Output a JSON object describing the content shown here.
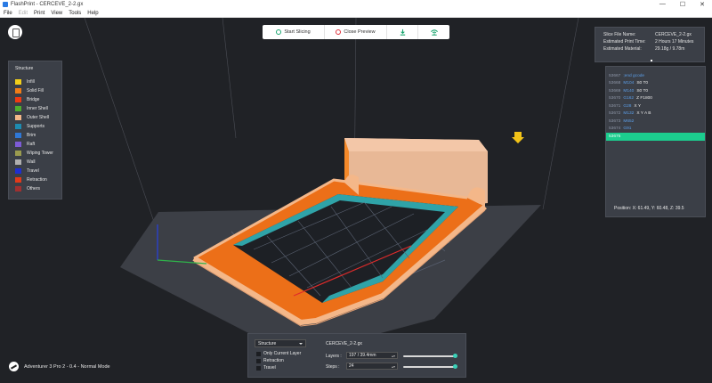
{
  "window": {
    "title": "FlashPrint - CERCEVE_2-2.gx",
    "controls": [
      "—",
      "☐",
      "✕"
    ]
  },
  "menu": [
    "File",
    "Edit",
    "Print",
    "View",
    "Tools",
    "Help"
  ],
  "toolbar": {
    "start_slicing": "Start Slicing",
    "close_preview": "Close Preview"
  },
  "legend": {
    "title": "Structure",
    "items": [
      {
        "label": "Infill",
        "color": "#f2cf1b"
      },
      {
        "label": "Solid Fill",
        "color": "#f07d18"
      },
      {
        "label": "Bridge",
        "color": "#f03a12"
      },
      {
        "label": "Inner Shell",
        "color": "#4fae2d"
      },
      {
        "label": "Outer Shell",
        "color": "#f4b789"
      },
      {
        "label": "Supports",
        "color": "#1e8bb0"
      },
      {
        "label": "Brim",
        "color": "#2f78d6"
      },
      {
        "label": "Raft",
        "color": "#7d5bd6"
      },
      {
        "label": "Wiping Tower",
        "color": "#9a9b4f"
      },
      {
        "label": "Wall",
        "color": "#b0b0b0"
      },
      {
        "label": "Travel",
        "color": "#1f2fd0"
      },
      {
        "label": "Retraction",
        "color": "#e23a1a"
      },
      {
        "label": "Others",
        "color": "#a03030"
      }
    ]
  },
  "info": {
    "slice_file_name_label": "Slice File Name:",
    "slice_file_name": "CERCEVE_2-2.gx",
    "print_time_label": "Estimated Print Time:",
    "print_time": "2 Hours 17 Minutes",
    "material_label": "Estimated Material:",
    "material": "29.18g / 9.78m"
  },
  "gcode": {
    "lines": [
      {
        "n": "53667",
        "cmd": ";end gcode",
        "args": ""
      },
      {
        "n": "53668",
        "cmd": "M104",
        "args": "S0 T0"
      },
      {
        "n": "53669",
        "cmd": "M140",
        "args": "S0 T0"
      },
      {
        "n": "53670",
        "cmd": "G162",
        "args": "Z F1800"
      },
      {
        "n": "53671",
        "cmd": "G28",
        "args": "X Y"
      },
      {
        "n": "53672",
        "cmd": "M132",
        "args": "X Y A B"
      },
      {
        "n": "53673",
        "cmd": "M652",
        "args": ""
      },
      {
        "n": "53674",
        "cmd": "G91",
        "args": ""
      },
      {
        "n": "53675",
        "cmd": "",
        "args": ""
      }
    ],
    "position": "Position:  X: 61.49, Y: 60.48, Z: 39.5"
  },
  "bottom": {
    "view_mode": "Structure",
    "options": [
      "Only Current Layer",
      "Retraction",
      "Travel"
    ],
    "file_name": "CERCEVE_2-2.gx",
    "layers_label": "Layers :",
    "layers_value": "197 / 39.4mm",
    "steps_label": "Steps :",
    "steps_value": "24",
    "layers_progress": 1.0,
    "steps_progress": 1.0
  },
  "status": {
    "printer": "Adventurer 3 Pro 2 - 0.4 - Normal Mode"
  },
  "colors": {
    "toolbar_start_icon": "#1aa56f",
    "toolbar_close_icon": "#e0323c",
    "gcode_selected": "#1ccd8e",
    "slider_knob": "#3ad1b8"
  }
}
